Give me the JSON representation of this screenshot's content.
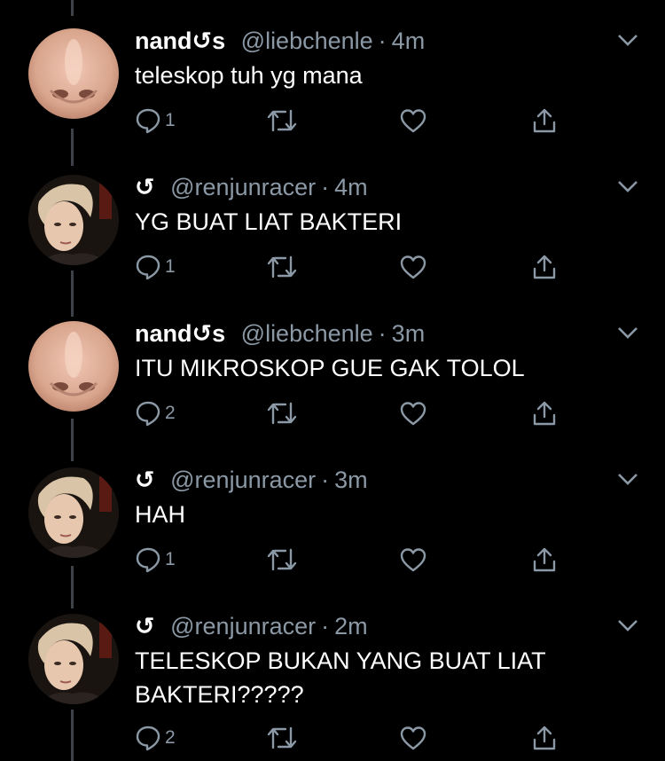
{
  "tweets": [
    {
      "name": "nand",
      "name_glyph": "↺s",
      "handle": "@liebchenle",
      "sep": "·",
      "time": "4m",
      "text": "teleskop tuh yg mana",
      "replies": "1"
    },
    {
      "name": "",
      "name_glyph": "↺",
      "handle": "@renjunracer",
      "sep": "·",
      "time": "4m",
      "text": "YG BUAT LIAT BAKTERI",
      "replies": "1"
    },
    {
      "name": "nand",
      "name_glyph": "↺s",
      "handle": "@liebchenle",
      "sep": "·",
      "time": "3m",
      "text": "ITU MIKROSKOP GUE GAK TOLOL",
      "replies": "2"
    },
    {
      "name": "",
      "name_glyph": "↺",
      "handle": "@renjunracer",
      "sep": "·",
      "time": "3m",
      "text": "HAH",
      "replies": "1"
    },
    {
      "name": "",
      "name_glyph": "↺",
      "handle": "@renjunracer",
      "sep": "·",
      "time": "2m",
      "text": "TELESKOP BUKAN YANG BUAT LIAT BAKTERI?????",
      "replies": "2"
    }
  ],
  "icons": {
    "reply": "reply-icon",
    "retweet": "retweet-icon",
    "like": "heart-icon",
    "share": "share-icon",
    "more": "chevron-down-icon"
  },
  "colors": {
    "background": "#000000",
    "text": "#ffffff",
    "muted": "#8b98a5",
    "thread_line": "#3d4148"
  }
}
